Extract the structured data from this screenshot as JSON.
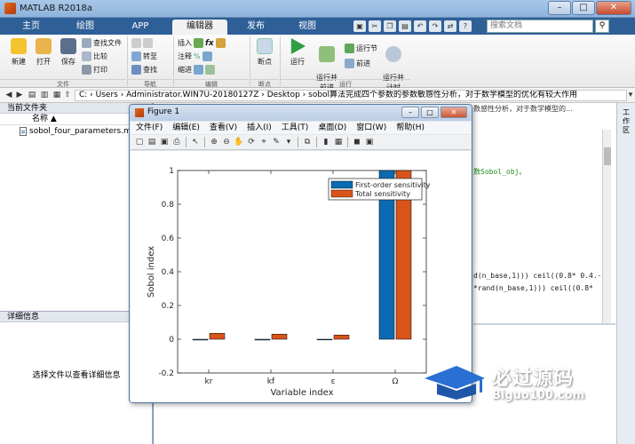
{
  "window": {
    "title": "MATLAB R2018a"
  },
  "tabs": [
    {
      "label": "主页"
    },
    {
      "label": "绘图"
    },
    {
      "label": "APP"
    },
    {
      "label": "编辑器"
    },
    {
      "label": "发布"
    },
    {
      "label": "视图"
    }
  ],
  "search": {
    "placeholder": "搜索文档"
  },
  "ribbon": {
    "new": "新建",
    "open": "打开",
    "save": "保存",
    "find_files": "查找文件",
    "compare": "比较",
    "print": "打印",
    "goto": "转至",
    "find": "查找",
    "insert": "插入",
    "fx": "fx",
    "comment": "注释",
    "indent": "缩进",
    "breakpoints": "断点",
    "run": "运行",
    "run_advance": "运行并\n前进",
    "run_section": "运行节",
    "advance": "前进",
    "run_time": "运行并\n计时",
    "groups": {
      "file": "文件",
      "navigate": "导航",
      "edit": "编辑",
      "breakpoints": "断点",
      "run": "运行"
    }
  },
  "address": {
    "path": "C: › Users › Administrator.WIN7U-20180127Z › Desktop › sobol算法完成四个参数的参数敏感性分析，对于数学模型的优化有较大作用"
  },
  "current_folder": {
    "header": "当前文件夹",
    "column": "名称 ▲",
    "files": [
      {
        "name": "sobol_four_parameters.m"
      }
    ]
  },
  "details": {
    "header": "详细信息",
    "hint": "选择文件以查看详细信息"
  },
  "editor": {
    "tab_text": "数感性分析，对于数学模型的...",
    "code_lines": [
      "数Sobol_obj。",
      "d(n_base,1))) ceil((0.8* 0.4.·",
      "*rand(n_base,1))) ceil((0.8*"
    ]
  },
  "right_strip": {
    "label": "工作区"
  },
  "figure": {
    "title": "Figure 1",
    "menu": [
      "文件(F)",
      "编辑(E)",
      "查看(V)",
      "插入(I)",
      "工具(T)",
      "桌面(D)",
      "窗口(W)",
      "帮助(H)"
    ]
  },
  "colors": {
    "first_order": "#0b6ab1",
    "total": "#d9541a"
  },
  "chart_data": {
    "type": "bar",
    "categories": [
      "kr",
      "kf",
      "ε",
      "Ω"
    ],
    "series": [
      {
        "name": "First-order sensitivity",
        "values": [
          -0.005,
          -0.005,
          0.0,
          1.0
        ]
      },
      {
        "name": "Total sensitivity",
        "values": [
          0.035,
          0.03,
          0.025,
          1.0
        ]
      }
    ],
    "xlabel": "Variable index",
    "ylabel": "Sobol index",
    "ylim": [
      -0.2,
      1.0
    ],
    "yticks": [
      -0.2,
      0,
      0.2,
      0.4,
      0.6,
      0.8,
      1
    ],
    "legend": "top-right",
    "grid": false
  },
  "watermark": {
    "cn": "必过源码",
    "en": "Biguo100.com"
  }
}
